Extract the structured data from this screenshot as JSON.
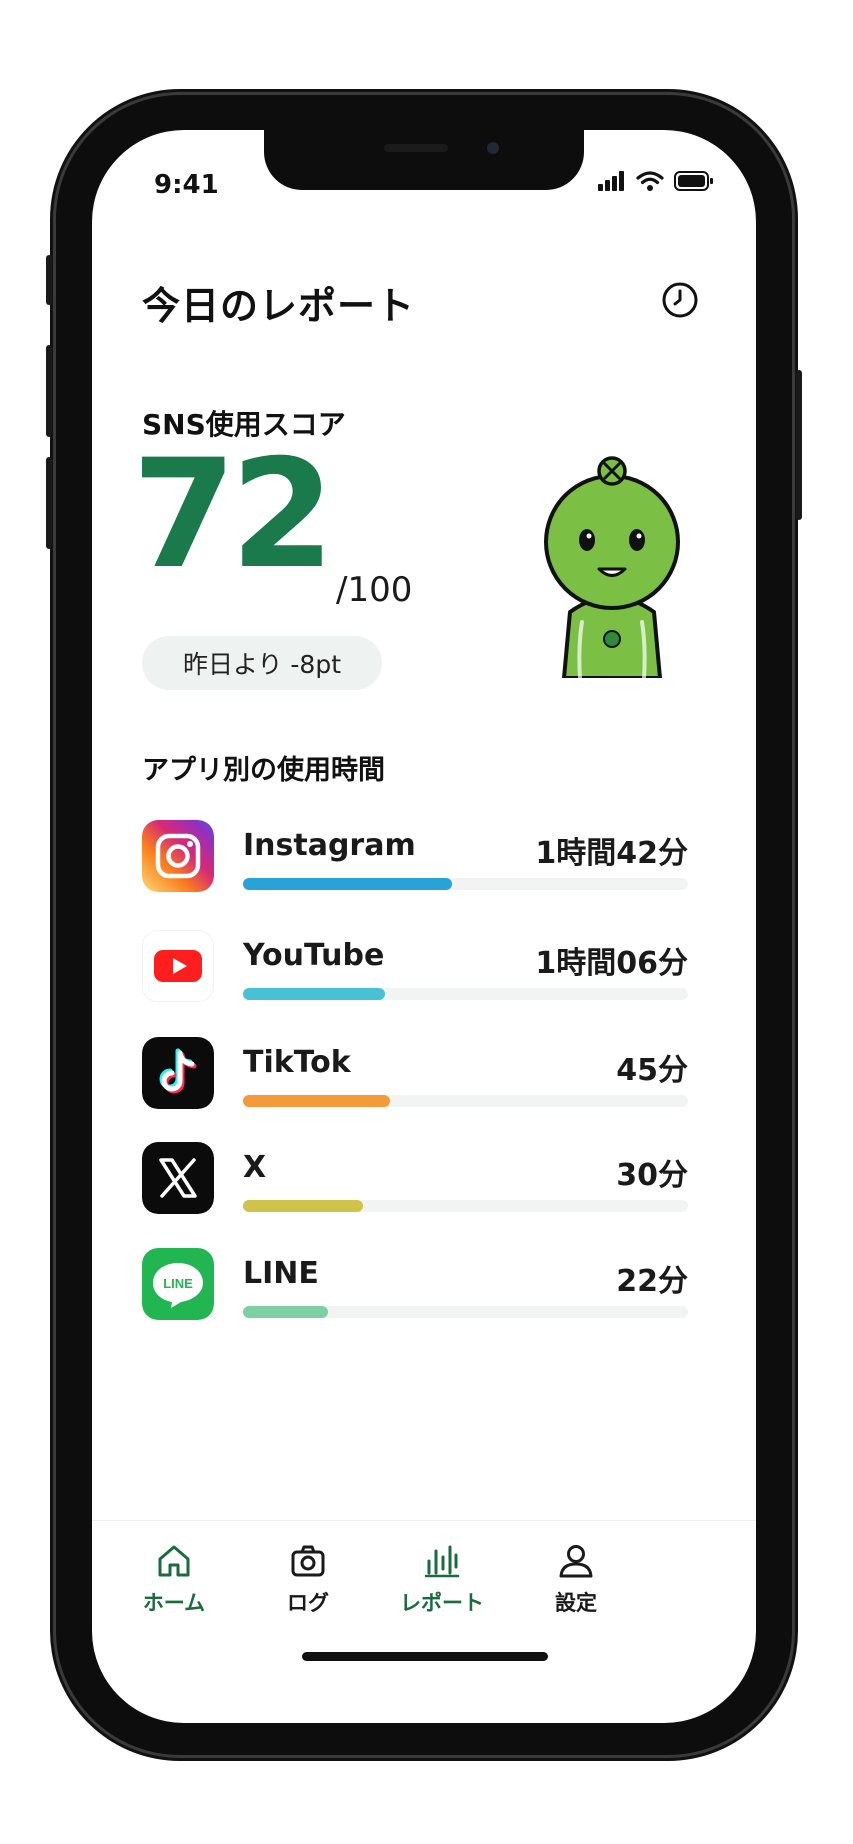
{
  "status_bar": {
    "time": "9:41"
  },
  "header": {
    "title": "今日のレポート"
  },
  "score": {
    "label": "SNS使用スコア",
    "value": "72",
    "max": "/100",
    "delta": "昨日より -8pt",
    "accent_color": "#1b7a4c"
  },
  "apps_section": {
    "title": "アプリ別の使用時間",
    "apps": [
      {
        "name": "Instagram",
        "time": "1時間42分",
        "ratio": 0.47,
        "color": "#27a3d8",
        "icon": "instagram-icon"
      },
      {
        "name": "YouTube",
        "time": "1時間06分",
        "ratio": 0.32,
        "color": "#48c1d6",
        "icon": "youtube-icon"
      },
      {
        "name": "TikTok",
        "time": "45分",
        "ratio": 0.33,
        "color": "#f49a3a",
        "icon": "tiktok-icon"
      },
      {
        "name": "X",
        "time": "30分",
        "ratio": 0.27,
        "color": "#cfc34a",
        "icon": "x-icon"
      },
      {
        "name": "LINE",
        "time": "22分",
        "ratio": 0.19,
        "color": "#7ed0a3",
        "icon": "line-icon"
      }
    ]
  },
  "tabbar": {
    "tabs": [
      {
        "label": "ホーム",
        "icon": "home-icon",
        "color": "#1b6b3f"
      },
      {
        "label": "ログ",
        "icon": "camera-icon",
        "color": "#1a1a1a"
      },
      {
        "label": "レポート",
        "icon": "report-icon",
        "color": "#1b6b3f"
      },
      {
        "label": "設定",
        "icon": "person-icon",
        "color": "#1a1a1a"
      }
    ]
  }
}
